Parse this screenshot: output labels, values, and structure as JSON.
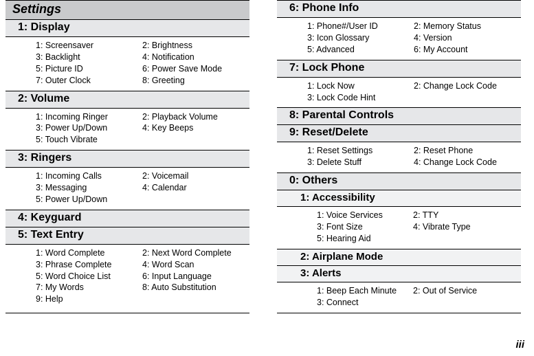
{
  "page_number": "iii",
  "left": {
    "title": "Settings",
    "s1": {
      "header": "1: Display",
      "i": [
        "1: Screensaver",
        "2: Brightness",
        "3: Backlight",
        "4: Notification",
        "5: Picture ID",
        "6: Power Save Mode",
        "7: Outer Clock",
        "8: Greeting"
      ]
    },
    "s2": {
      "header": "2: Volume",
      "i": [
        "1: Incoming Ringer",
        "2: Playback Volume",
        "3: Power Up/Down",
        "4: Key Beeps",
        "5: Touch Vibrate",
        ""
      ]
    },
    "s3": {
      "header": "3: Ringers",
      "i": [
        "1: Incoming Calls",
        "2: Voicemail",
        "3: Messaging",
        "4: Calendar",
        "5: Power Up/Down",
        ""
      ]
    },
    "s4": {
      "header": "4: Keyguard"
    },
    "s5": {
      "header": "5: Text Entry",
      "i": [
        "1: Word Complete",
        "2: Next Word Complete",
        "3: Phrase Complete",
        "4: Word Scan",
        "5: Word Choice List",
        "6: Input Language",
        "7: My Words",
        "8: Auto Substitution",
        "9: Help",
        ""
      ]
    }
  },
  "right": {
    "s6": {
      "header": "6: Phone Info",
      "i": [
        "1: Phone#/User ID",
        "2: Memory Status",
        "3: Icon Glossary",
        "4: Version",
        "5: Advanced",
        "6: My Account"
      ]
    },
    "s7": {
      "header": "7: Lock Phone",
      "i": [
        "1: Lock Now",
        "2: Change Lock Code",
        "3: Lock Code Hint",
        ""
      ]
    },
    "s8": {
      "header": "8: Parental Controls"
    },
    "s9": {
      "header": "9: Reset/Delete",
      "i": [
        "1: Reset Settings",
        "2: Reset Phone",
        "3: Delete Stuff",
        "4: Change Lock Code"
      ]
    },
    "s0": {
      "header": "0: Others",
      "sub1": {
        "header": "1: Accessibility",
        "i": [
          "1: Voice Services",
          "2: TTY",
          "3: Font Size",
          "4: Vibrate Type",
          "5: Hearing Aid",
          ""
        ]
      },
      "sub2": {
        "header": "2: Airplane Mode"
      },
      "sub3": {
        "header": "3: Alerts",
        "i": [
          "1: Beep Each Minute",
          "2: Out of Service",
          "3: Connect",
          ""
        ]
      }
    }
  }
}
